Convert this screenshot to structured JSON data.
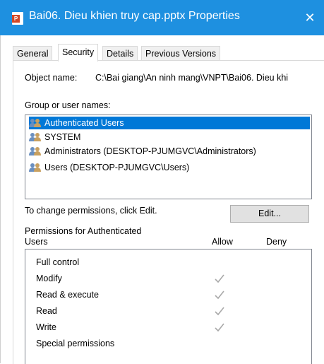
{
  "window": {
    "title": "Bai06. Dieu khien truy cap.pptx Properties",
    "file_badge": "P",
    "close_glyph": "✕"
  },
  "tabs": [
    {
      "label": "General",
      "active": false
    },
    {
      "label": "Security",
      "active": true
    },
    {
      "label": "Details",
      "active": false
    },
    {
      "label": "Previous Versions",
      "active": false
    }
  ],
  "object": {
    "label": "Object name:",
    "value": "C:\\Bai giang\\An ninh mang\\VNPT\\Bai06. Dieu khi"
  },
  "groups": {
    "label": "Group or user names:",
    "items": [
      {
        "label": "Authenticated Users",
        "selected": true,
        "icon": "users-group-icon"
      },
      {
        "label": "SYSTEM",
        "selected": false,
        "icon": "users-group-icon"
      },
      {
        "label": "Administrators (DESKTOP-PJUMGVC\\Administrators)",
        "selected": false,
        "icon": "users-group-icon"
      },
      {
        "label": "Users (DESKTOP-PJUMGVC\\Users)",
        "selected": false,
        "icon": "users-group-icon"
      }
    ]
  },
  "edit": {
    "hint": "To change permissions, click Edit.",
    "button_label": "Edit..."
  },
  "permissions": {
    "header_line1": "Permissions for Authenticated",
    "header_line2": "Users",
    "allow_label": "Allow",
    "deny_label": "Deny",
    "rows": [
      {
        "name": "Full control",
        "allow": false,
        "deny": false
      },
      {
        "name": "Modify",
        "allow": true,
        "deny": false
      },
      {
        "name": "Read & execute",
        "allow": true,
        "deny": false
      },
      {
        "name": "Read",
        "allow": true,
        "deny": false
      },
      {
        "name": "Write",
        "allow": true,
        "deny": false
      },
      {
        "name": "Special permissions",
        "allow": false,
        "deny": false
      }
    ]
  },
  "colors": {
    "titlebar": "#1e90e0",
    "selection": "#0078d7",
    "check": "#a9a9a9"
  }
}
